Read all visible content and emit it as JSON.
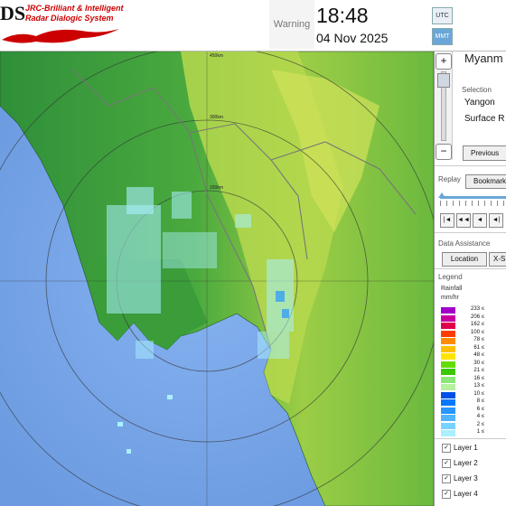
{
  "header": {
    "logo_text": "DS",
    "brand_line1": "JRC-Brilliant & Intelligent",
    "brand_line2": "Radar Dialogic System",
    "warning_label": "Warning",
    "time": "18:48",
    "date": "04 Nov 2025",
    "tz_buttons": [
      "UTC",
      "MMT"
    ]
  },
  "panel": {
    "country": "Myanm",
    "selection_heading": "Selection",
    "selection_values": [
      "Yangon",
      "Surface R"
    ],
    "previous_label": "Previous",
    "replay_heading": "Replay",
    "bookmark_label": "Bookmark",
    "playback_icons": [
      "|◄",
      "◄◄",
      "◄",
      "◄|"
    ],
    "data_assistance_heading": "Data Assistance",
    "location_label": "Location",
    "xs_label": "X-S",
    "legend_heading": "Legend",
    "legend_subtitle_1": "Rainfall",
    "legend_subtitle_2": "mm/hr",
    "legend_items": [
      {
        "value": "233 ≤",
        "color": "#a000c8"
      },
      {
        "value": "206 ≤",
        "color": "#c800a0"
      },
      {
        "value": "162 ≤",
        "color": "#e0004a"
      },
      {
        "value": "100 ≤",
        "color": "#ff3c00"
      },
      {
        "value": "78 ≤",
        "color": "#ff8c00"
      },
      {
        "value": "61 ≤",
        "color": "#ffbe00"
      },
      {
        "value": "48 ≤",
        "color": "#ffe400"
      },
      {
        "value": "30 ≤",
        "color": "#64dc00"
      },
      {
        "value": "21 ≤",
        "color": "#3cc800"
      },
      {
        "value": "16 ≤",
        "color": "#8ce678"
      },
      {
        "value": "13 ≤",
        "color": "#b4f0a0"
      },
      {
        "value": "10 ≤",
        "color": "#0050e6"
      },
      {
        "value": "8 ≤",
        "color": "#0078ff"
      },
      {
        "value": "6 ≤",
        "color": "#2896ff"
      },
      {
        "value": "4 ≤",
        "color": "#50b4ff"
      },
      {
        "value": "2 ≤",
        "color": "#78d2ff"
      },
      {
        "value": "1 ≤",
        "color": "#aaf0ff"
      }
    ],
    "layers": [
      "Layer 1",
      "Layer 2",
      "Layer 3",
      "Layer 4"
    ]
  },
  "map": {
    "range_labels": [
      "150km",
      "300km",
      "450km"
    ],
    "sea_color": "#7aa8ec",
    "land_color": "#3fa33f",
    "highland_color": "#a8d24a",
    "echo_color": "#aaf0ff"
  }
}
